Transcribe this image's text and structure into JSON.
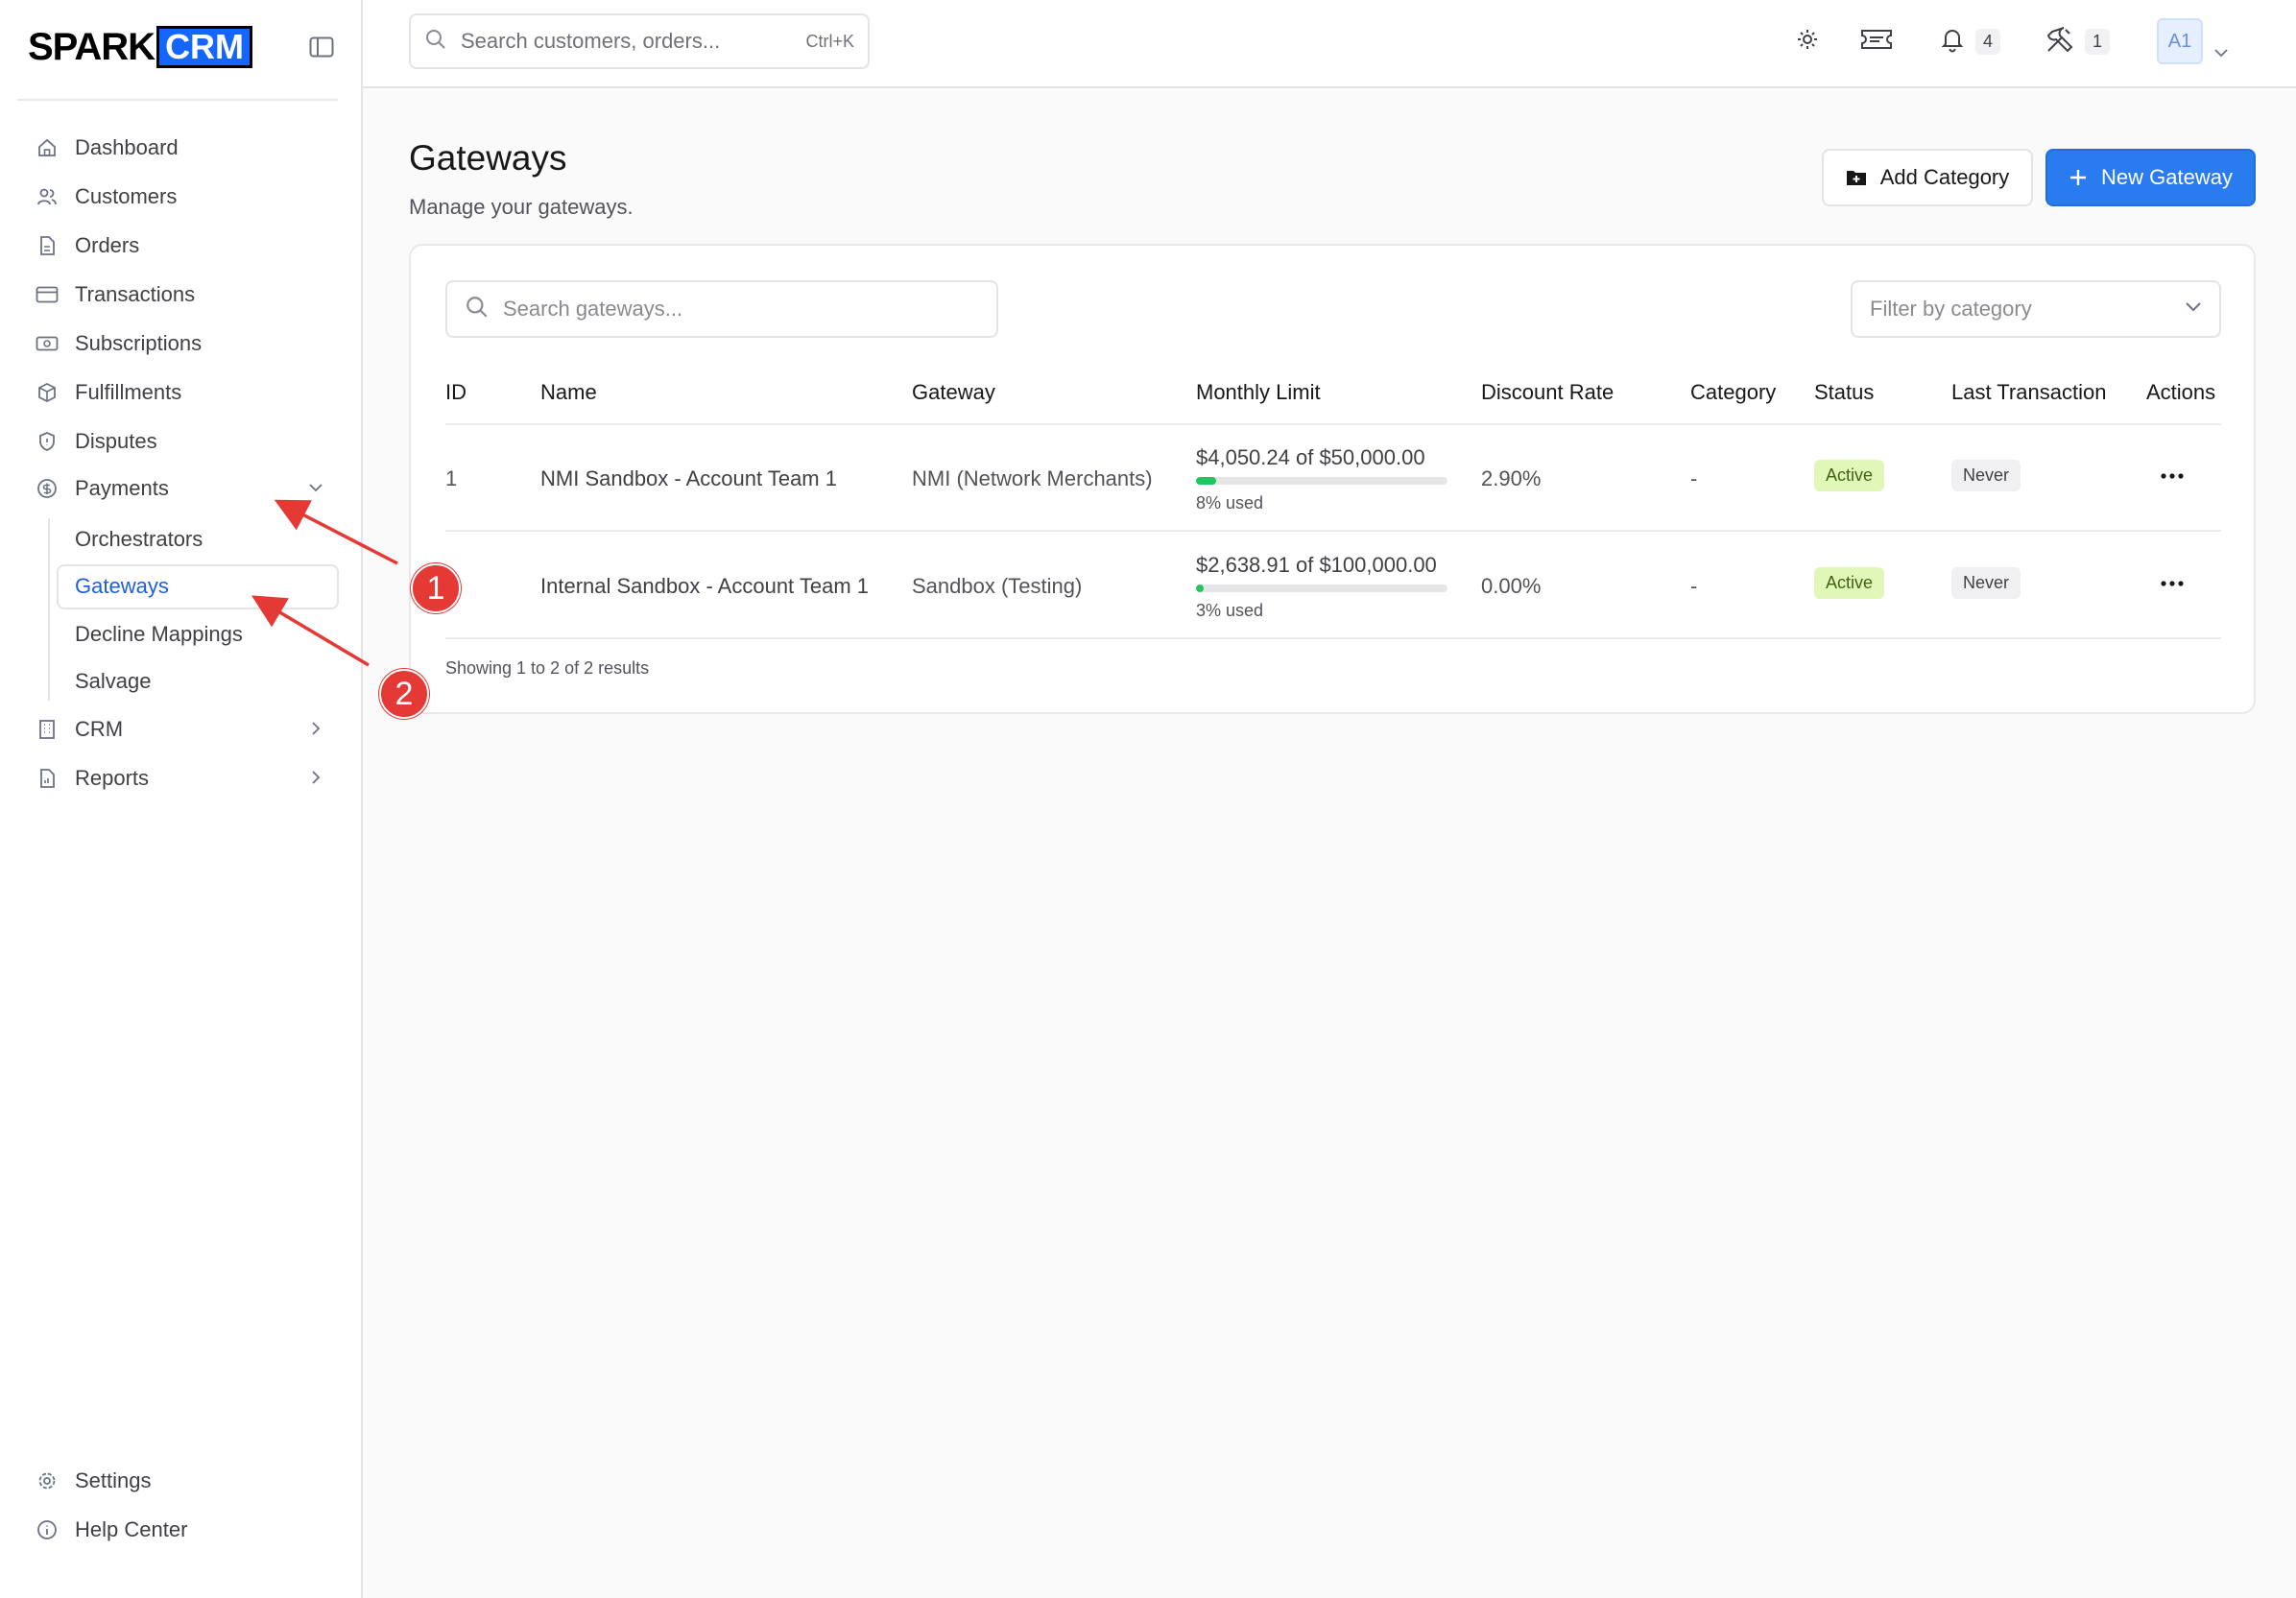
{
  "brand": {
    "part1": "SPARK",
    "part2": "CRM"
  },
  "sidebar": {
    "items": [
      {
        "label": "Dashboard",
        "icon": "home-icon"
      },
      {
        "label": "Customers",
        "icon": "users-icon"
      },
      {
        "label": "Orders",
        "icon": "file-icon"
      },
      {
        "label": "Transactions",
        "icon": "credit-card-icon"
      },
      {
        "label": "Subscriptions",
        "icon": "banknote-icon"
      },
      {
        "label": "Fulfillments",
        "icon": "package-icon"
      },
      {
        "label": "Disputes",
        "icon": "shield-icon"
      },
      {
        "label": "Payments",
        "icon": "dollar-circle-icon"
      }
    ],
    "payments_sub": [
      "Orchestrators",
      "Gateways",
      "Decline Mappings",
      "Salvage"
    ],
    "after": [
      {
        "label": "CRM",
        "icon": "building-icon"
      },
      {
        "label": "Reports",
        "icon": "report-icon"
      }
    ],
    "bottom": [
      {
        "label": "Settings",
        "icon": "gear-icon"
      },
      {
        "label": "Help Center",
        "icon": "info-icon"
      }
    ]
  },
  "topbar": {
    "search_placeholder": "Search customers, orders...",
    "shortcut": "Ctrl+K",
    "notifications_count": "4",
    "tools_count": "1",
    "avatar": "A1"
  },
  "page": {
    "title": "Gateways",
    "subtitle": "Manage your gateways.",
    "add_category": "Add Category",
    "new_gateway": "New Gateway"
  },
  "table": {
    "search_placeholder": "Search gateways...",
    "filter_placeholder": "Filter by category",
    "headers": [
      "ID",
      "Name",
      "Gateway",
      "Monthly Limit",
      "Discount Rate",
      "Category",
      "Status",
      "Last Transaction",
      "Actions"
    ],
    "rows": [
      {
        "id": "1",
        "name": "NMI Sandbox - Account Team 1",
        "gateway": "NMI (Network Merchants)",
        "limit_text": "$4,050.24 of $50,000.00",
        "used_pct": 8,
        "used_text": "8% used",
        "discount": "2.90%",
        "category": "-",
        "status": "Active",
        "last": "Never"
      },
      {
        "id": "",
        "name": "Internal Sandbox - Account Team 1",
        "gateway": "Sandbox (Testing)",
        "limit_text": "$2,638.91 of $100,000.00",
        "used_pct": 3,
        "used_text": "3% used",
        "discount": "0.00%",
        "category": "-",
        "status": "Active",
        "last": "Never"
      }
    ],
    "footer": "Showing 1 to 2 of 2 results"
  },
  "annotations": {
    "marker1": "1",
    "marker2": "2"
  },
  "colors": {
    "accent": "#2b7bf0",
    "active_badge": "#e1f7b8",
    "progress": "#22c55e",
    "annotation": "#e53935"
  }
}
